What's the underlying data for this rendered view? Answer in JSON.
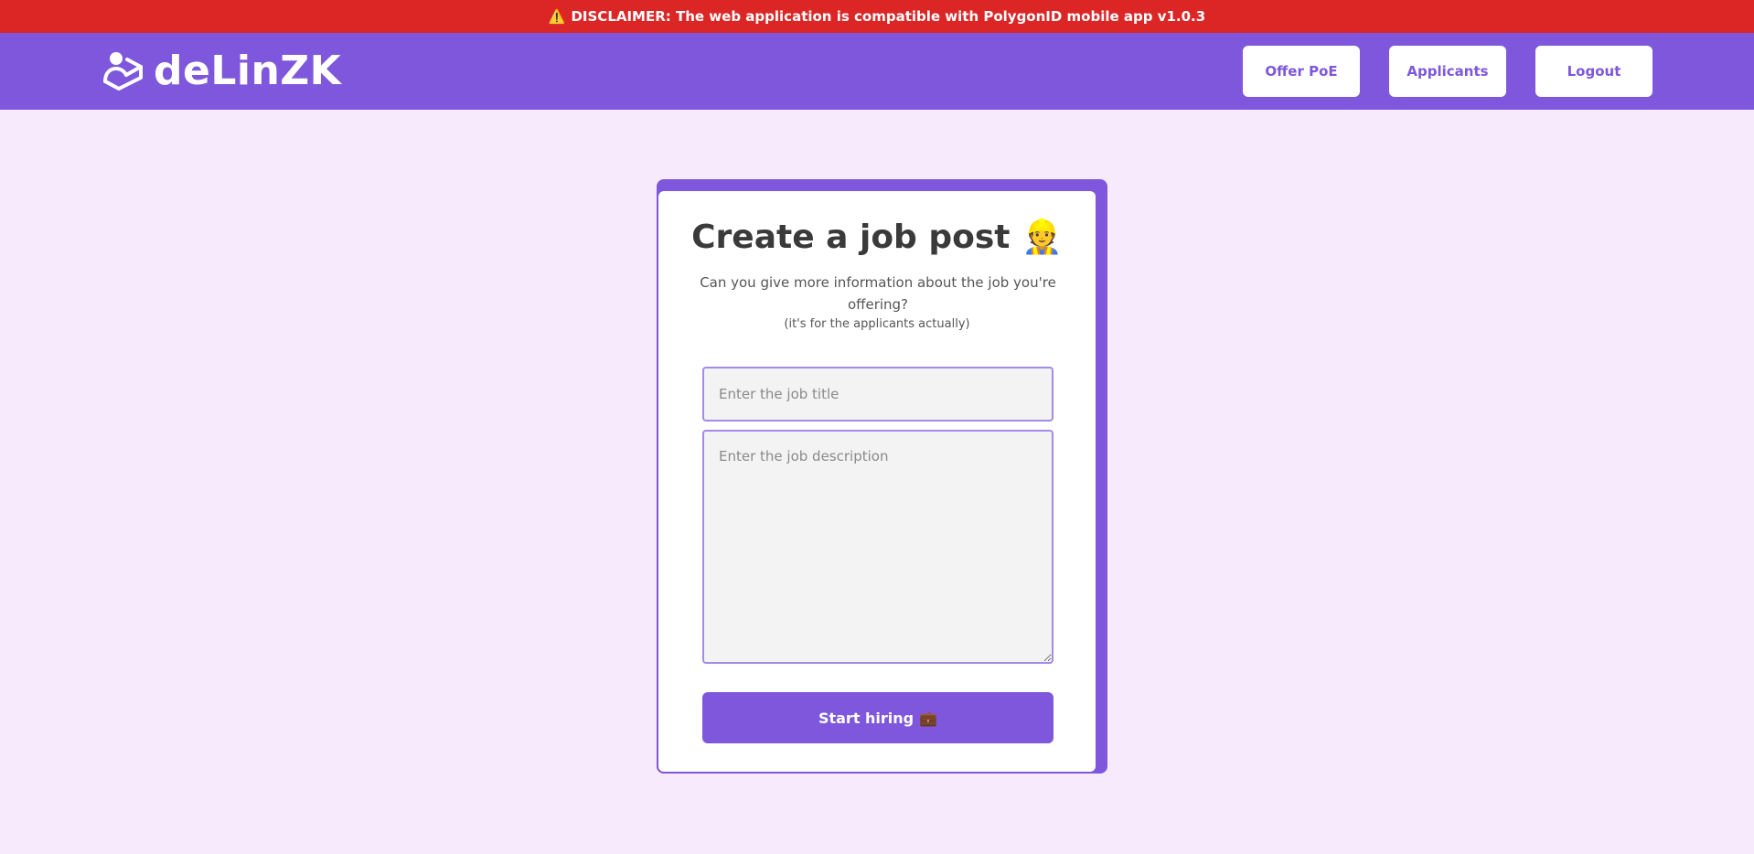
{
  "banner": {
    "icon": "warning-icon",
    "warning_glyph": "⚠️",
    "text": "DISCLAIMER: The web application is compatible with PolygonID mobile app v1.0.3"
  },
  "header": {
    "brand": "deLinZK",
    "nav": {
      "offer_label": "Offer PoE",
      "applicants_label": "Applicants",
      "logout_label": "Logout"
    }
  },
  "form": {
    "title": "Create a job post",
    "title_emoji": "👷",
    "subtitle": "Can you give more information about the job you're offering?",
    "note": "(it's for the applicants actually)",
    "job_title": {
      "value": "",
      "placeholder": "Enter the job title"
    },
    "job_description": {
      "value": "",
      "placeholder": "Enter the job description"
    },
    "submit_label": "Start hiring",
    "submit_emoji": "💼"
  },
  "colors": {
    "brand": "#7e57dc",
    "banner": "#dc2626",
    "background": "#f8eafd"
  }
}
